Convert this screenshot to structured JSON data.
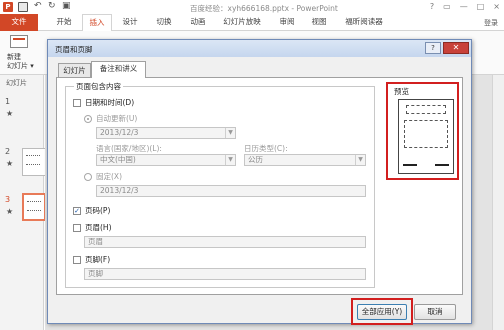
{
  "app": {
    "icon_letter": "P",
    "title": "百度经验：xyh666168.pptx - PowerPoint",
    "window_controls": [
      "?",
      "▭",
      "—",
      "□",
      "×"
    ],
    "user": "登录"
  },
  "ribbon": {
    "tabs": [
      "文件",
      "开始",
      "插入",
      "设计",
      "切换",
      "动画",
      "幻灯片放映",
      "审阅",
      "视图",
      "福昕阅读器"
    ],
    "active_tab": "插入",
    "new_slide_label": "新建\n幻灯片 ▾"
  },
  "thumbs": {
    "header": "幻灯片",
    "slides": [
      {
        "num": "1",
        "star": "★"
      },
      {
        "num": "2",
        "star": "★"
      },
      {
        "num": "3",
        "star": "★"
      }
    ]
  },
  "dialog": {
    "title": "页眉和页脚",
    "help": "?",
    "close": "✕",
    "tabs": [
      "幻灯片",
      "备注和讲义"
    ],
    "active_tab": "备注和讲义",
    "group_label": "页面包含内容",
    "datetime": {
      "label": "日期和时间(D)",
      "checked": false,
      "auto_update_label": "自动更新(U)",
      "auto_update_value": "2013/12/3",
      "language_label": "语言(国家/地区)(L):",
      "language_value": "中文(中国)",
      "calendar_label": "日历类型(C):",
      "calendar_value": "公历",
      "fixed_label": "固定(X)",
      "fixed_value": "2013/12/3"
    },
    "page_number": {
      "label": "页码(P)",
      "checked": true
    },
    "header": {
      "label": "页眉(H)",
      "checked": false,
      "value": "页眉"
    },
    "footer": {
      "label": "页脚(F)",
      "checked": false,
      "value": "页脚"
    },
    "preview_label": "预览",
    "apply_all_button": "全部应用(Y)",
    "cancel_button": "取消",
    "highlight_color": "#d21f1f"
  }
}
